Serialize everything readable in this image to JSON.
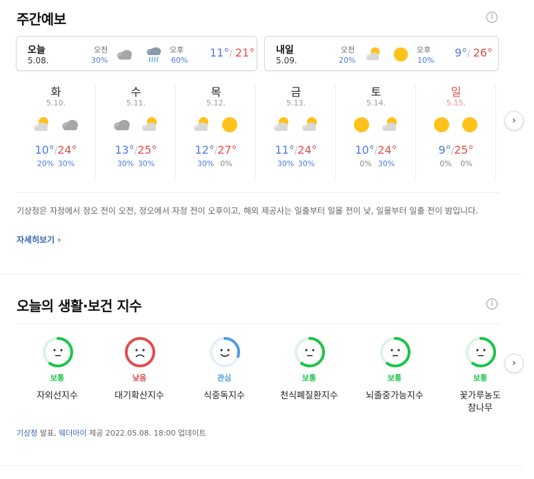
{
  "weekly": {
    "title": "주간예보",
    "info_icon": "info-icon",
    "cards": [
      {
        "name": "오늘",
        "date": "5.08.",
        "am_label": "오전",
        "am_precip": "30%",
        "am_icon": "cloudy-icon",
        "pm_label": "오후",
        "pm_precip": "60%",
        "pm_icon": "rain-icon",
        "low": "11°",
        "high": "21°"
      },
      {
        "name": "내일",
        "date": "5.09.",
        "am_label": "오전",
        "am_precip": "20%",
        "am_icon": "partly-cloudy-icon",
        "pm_label": "오후",
        "pm_precip": "10%",
        "pm_icon": "sunny-icon",
        "low": "9°",
        "high": "26°"
      }
    ],
    "days": [
      {
        "weekday": "화",
        "date": "5.10.",
        "am_icon": "partly-cloudy-icon",
        "pm_icon": "cloudy-icon",
        "low": "10°",
        "high": "24°",
        "am_precip": "20%",
        "pm_precip": "30%"
      },
      {
        "weekday": "수",
        "date": "5.11.",
        "am_icon": "cloudy-icon",
        "pm_icon": "partly-cloudy-icon",
        "low": "13°",
        "high": "25°",
        "am_precip": "30%",
        "pm_precip": "30%"
      },
      {
        "weekday": "목",
        "date": "5.12.",
        "am_icon": "partly-cloudy-icon",
        "pm_icon": "sunny-icon",
        "low": "12°",
        "high": "27°",
        "am_precip": "30%",
        "pm_precip": "0%"
      },
      {
        "weekday": "금",
        "date": "5.13.",
        "am_icon": "partly-cloudy-icon",
        "pm_icon": "partly-cloudy-icon",
        "low": "11°",
        "high": "24°",
        "am_precip": "30%",
        "pm_precip": "30%"
      },
      {
        "weekday": "토",
        "date": "5.14.",
        "am_icon": "sunny-icon",
        "pm_icon": "partly-cloudy-icon",
        "low": "10°",
        "high": "24°",
        "am_precip": "0%",
        "pm_precip": "30%"
      },
      {
        "weekday": "일",
        "date": "5.15.",
        "am_icon": "sunny-icon",
        "pm_icon": "sunny-icon",
        "low": "9°",
        "high": "25°",
        "am_precip": "0%",
        "pm_precip": "0%"
      }
    ],
    "description": "기상청은 자정에서 정오 전이 오전, 정오에서 자정 전이 오후이고, 해외 제공사는 일출부터 일몰 전이 낮, 일몰부터 일출 전이 밤입니다.",
    "more_link": "자세히보기",
    "next_icon": "chevron-right-icon"
  },
  "health": {
    "title": "오늘의 생활·보건 지수",
    "info_icon": "info-icon",
    "indices": [
      {
        "name": "자외선지수",
        "status": "보통",
        "face": "neutral-face-icon",
        "level": 0.6
      },
      {
        "name": "대기확산지수",
        "status": "낮음",
        "face": "sad-face-icon",
        "level": 1.0
      },
      {
        "name": "식중독지수",
        "status": "관심",
        "face": "smile-face-icon",
        "level": 0.3
      },
      {
        "name": "천식폐질환지수",
        "status": "보통",
        "face": "neutral-face-icon",
        "level": 0.6
      },
      {
        "name": "뇌졸중가능지수",
        "status": "보통",
        "face": "neutral-face-icon",
        "level": 0.6
      },
      {
        "name": "꽃가루농도 참나무",
        "status": "보통",
        "face": "neutral-face-icon",
        "level": 0.6
      }
    ],
    "footer": {
      "source1": "기상청",
      "text1": " 발표, ",
      "source2": "웨더아이",
      "text2": " 제공 2022.05.08. 18:00 업데이트"
    },
    "next_icon": "chevron-right-icon"
  },
  "colors": {
    "low": "#4a7de0",
    "high": "#e34c4c",
    "normal": "#19c548",
    "bad": "#e34c4c",
    "concern": "#4a9de0"
  }
}
